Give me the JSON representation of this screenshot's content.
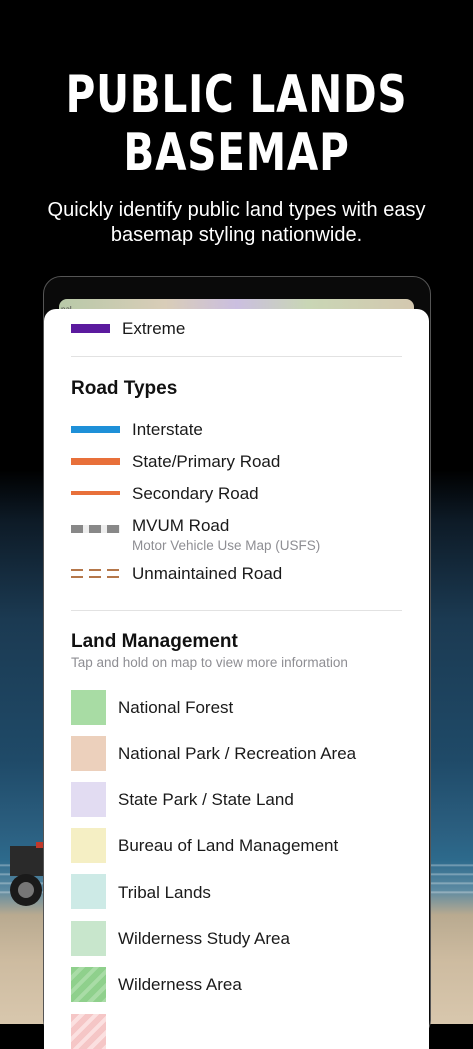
{
  "hero": {
    "title_line1": "PUBLIC LANDS",
    "title_line2": "BASEMAP",
    "subtitle": "Quickly identify public land types with easy basemap styling nationwide."
  },
  "map_peek_label": "nal",
  "legend": {
    "top_item": {
      "label": "Extreme",
      "color": "#5b1a9e"
    },
    "road_types": {
      "title": "Road Types",
      "items": [
        {
          "label": "Interstate",
          "color": "#1e90d8"
        },
        {
          "label": "State/Primary Road",
          "color": "#e8703a"
        },
        {
          "label": "Secondary Road",
          "color": "#e8703a"
        },
        {
          "label": "MVUM Road",
          "sublabel": "Motor Vehicle Use Map (USFS)",
          "color": "#888888"
        },
        {
          "label": "Unmaintained Road",
          "color": "#b5774a"
        }
      ]
    },
    "land_management": {
      "title": "Land Management",
      "subtitle": "Tap and hold on map to view more information",
      "items": [
        {
          "label": "National Forest",
          "color": "#a8dca4"
        },
        {
          "label": "National Park / Recreation Area",
          "color": "#ecd0bc"
        },
        {
          "label": "State Park / State Land",
          "color": "#e2dcf2"
        },
        {
          "label": "Bureau of Land Management",
          "color": "#f5efc4"
        },
        {
          "label": "Tribal Lands",
          "color": "#cdeae6"
        },
        {
          "label": "Wilderness Study Area",
          "color": "#c8e6cc"
        },
        {
          "label": "Wilderness Area",
          "color": "#8fd08c"
        }
      ]
    }
  }
}
